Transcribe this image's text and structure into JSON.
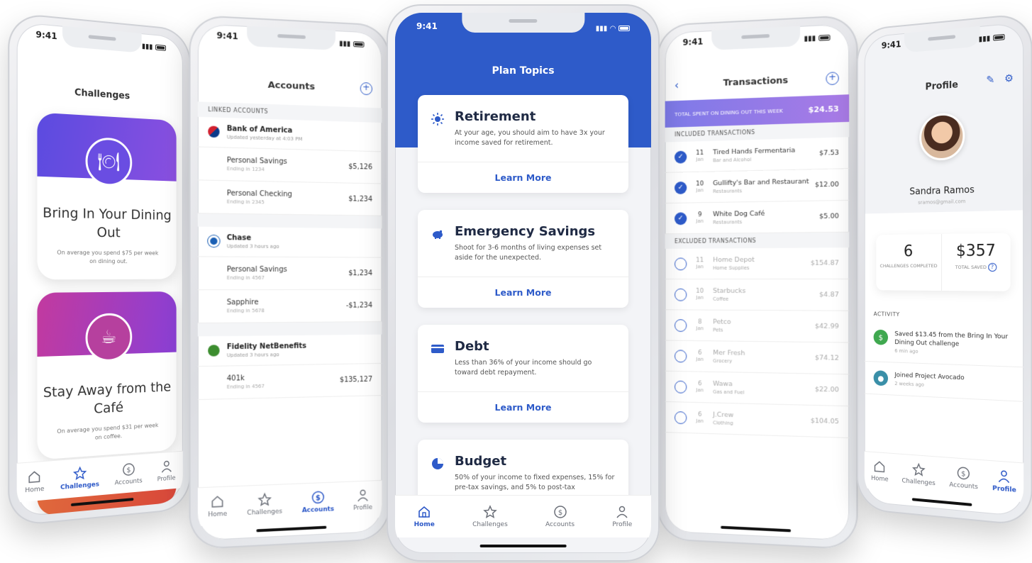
{
  "status_time": "9:41",
  "challenges_phone": {
    "title": "Challenges",
    "cards": [
      {
        "title": "Bring In Your Dining Out",
        "description": "On average you spend $75 per week on dining out."
      },
      {
        "title": "Stay Away from the Café",
        "description": "On average you spend $31 per week on coffee."
      }
    ],
    "tabs": [
      "Home",
      "Challenges",
      "Accounts",
      "Profile"
    ]
  },
  "accounts_phone": {
    "title": "Accounts",
    "section_label": "LINKED ACCOUNTS",
    "banks": [
      {
        "name": "Bank of America",
        "updated": "Updated yesterday at 4:03 PM",
        "accounts": [
          {
            "name": "Personal Savings",
            "ending": "Ending in 1234",
            "amount": "$5,126"
          },
          {
            "name": "Personal Checking",
            "ending": "Ending in 2345",
            "amount": "$1,234"
          }
        ]
      },
      {
        "name": "Chase",
        "updated": "Updated 3 hours ago",
        "accounts": [
          {
            "name": "Personal Savings",
            "ending": "Ending in 4567",
            "amount": "$1,234"
          },
          {
            "name": "Sapphire",
            "ending": "Ending in 5678",
            "amount": "-$1,234"
          }
        ]
      },
      {
        "name": "Fidelity NetBenefits",
        "updated": "Updated 3 hours ago",
        "accounts": [
          {
            "name": "401k",
            "ending": "Ending in 4567",
            "amount": "$135,127"
          }
        ]
      }
    ],
    "tabs": [
      "Home",
      "Challenges",
      "Accounts",
      "Profile"
    ]
  },
  "plan_phone": {
    "title": "Plan Topics",
    "topics": [
      {
        "title": "Retirement",
        "description": "At your age, you should aim to have 3x your income saved for retirement.",
        "cta": "Learn More"
      },
      {
        "title": "Emergency Savings",
        "description": "Shoot for 3-6 months of living expenses set aside for the unexpected.",
        "cta": "Learn More"
      },
      {
        "title": "Debt",
        "description": "Less than 36% of your income should go toward debt repayment.",
        "cta": "Learn More"
      },
      {
        "title": "Budget",
        "description": "50% of your income to fixed expenses, 15% for pre-tax savings, and 5% to post-tax",
        "cta": ""
      }
    ],
    "tabs": [
      "Home",
      "Challenges",
      "Accounts",
      "Profile"
    ]
  },
  "transactions_phone": {
    "title": "Transactions",
    "total_label": "TOTAL SPENT ON DINING OUT THIS WEEK",
    "total_amount": "$24.53",
    "included_label": "INCLUDED TRANSACTIONS",
    "excluded_label": "EXCLUDED TRANSACTIONS",
    "included": [
      {
        "day": "11",
        "mon": "Jan",
        "name": "Tired Hands Fermentaria",
        "cat": "Bar and Alcohol",
        "amount": "$7.53"
      },
      {
        "day": "10",
        "mon": "Jan",
        "name": "Gullifty's Bar and Restaurant",
        "cat": "Restaurants",
        "amount": "$12.00"
      },
      {
        "day": "9",
        "mon": "Jan",
        "name": "White Dog Café",
        "cat": "Restaurants",
        "amount": "$5.00"
      }
    ],
    "excluded": [
      {
        "day": "11",
        "mon": "Jan",
        "name": "Home Depot",
        "cat": "Home Supplies",
        "amount": "$154.87"
      },
      {
        "day": "10",
        "mon": "Jan",
        "name": "Starbucks",
        "cat": "Coffee",
        "amount": "$4.87"
      },
      {
        "day": "8",
        "mon": "Jan",
        "name": "Petco",
        "cat": "Pets",
        "amount": "$42.99"
      },
      {
        "day": "6",
        "mon": "Jan",
        "name": "Mer Fresh",
        "cat": "Grocery",
        "amount": "$74.12"
      },
      {
        "day": "6",
        "mon": "Jan",
        "name": "Wawa",
        "cat": "Gas and Fuel",
        "amount": "$22.00"
      },
      {
        "day": "6",
        "mon": "Jan",
        "name": "J.Crew",
        "cat": "Clothing",
        "amount": "$104.05"
      }
    ]
  },
  "profile_phone": {
    "title": "Profile",
    "name": "Sandra Ramos",
    "email": "sramos@gmail.com",
    "challenges_completed": "6",
    "challenges_label": "CHALLENGES COMPLETED",
    "total_saved": "$357",
    "total_saved_label": "TOTAL SAVED",
    "activity_label": "ACTIVITY",
    "activity": [
      {
        "text": "Saved $13.45 from the Bring In Your Dining Out challenge",
        "time": "6 min ago"
      },
      {
        "text": "Joined Project Avocado",
        "time": "2 weeks ago"
      }
    ],
    "tabs": [
      "Home",
      "Challenges",
      "Accounts",
      "Profile"
    ]
  },
  "colors": {
    "primary": "#2e5bc9",
    "purple": "#7d4ee0",
    "magenta": "#c13aa0",
    "orange": "#e05a3c"
  }
}
